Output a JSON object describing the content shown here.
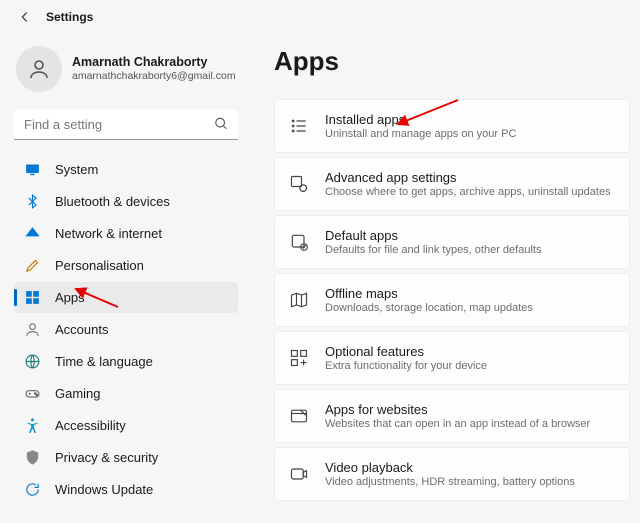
{
  "header": {
    "title": "Settings"
  },
  "profile": {
    "name": "Amarnath Chakraborty",
    "email": "amarnathchakraborty6@gmail.com"
  },
  "search": {
    "placeholder": "Find a setting"
  },
  "sidebar": {
    "items": [
      {
        "label": "System",
        "icon": "monitor",
        "color": "#0078d4"
      },
      {
        "label": "Bluetooth & devices",
        "icon": "bluetooth",
        "color": "#0078d4"
      },
      {
        "label": "Network & internet",
        "icon": "wifi",
        "color": "#0078d4"
      },
      {
        "label": "Personalisation",
        "icon": "brush",
        "color": "#c07a00"
      },
      {
        "label": "Apps",
        "icon": "apps",
        "color": "#0078d4",
        "active": true
      },
      {
        "label": "Accounts",
        "icon": "person",
        "color": "#777"
      },
      {
        "label": "Time & language",
        "icon": "globe",
        "color": "#1a7a7a"
      },
      {
        "label": "Gaming",
        "icon": "gamepad",
        "color": "#666"
      },
      {
        "label": "Accessibility",
        "icon": "accessibility",
        "color": "#0099cc"
      },
      {
        "label": "Privacy & security",
        "icon": "shield",
        "color": "#888"
      },
      {
        "label": "Windows Update",
        "icon": "update",
        "color": "#0078d4"
      }
    ]
  },
  "page": {
    "title": "Apps"
  },
  "cards": [
    {
      "title": "Installed apps",
      "sub": "Uninstall and manage apps on your PC",
      "icon": "list"
    },
    {
      "title": "Advanced app settings",
      "sub": "Choose where to get apps, archive apps, uninstall updates",
      "icon": "gear-app"
    },
    {
      "title": "Default apps",
      "sub": "Defaults for file and link types, other defaults",
      "icon": "default"
    },
    {
      "title": "Offline maps",
      "sub": "Downloads, storage location, map updates",
      "icon": "map"
    },
    {
      "title": "Optional features",
      "sub": "Extra functionality for your device",
      "icon": "plus-grid"
    },
    {
      "title": "Apps for websites",
      "sub": "Websites that can open in an app instead of a browser",
      "icon": "web-app"
    },
    {
      "title": "Video playback",
      "sub": "Video adjustments, HDR streaming, battery options",
      "icon": "video"
    }
  ]
}
